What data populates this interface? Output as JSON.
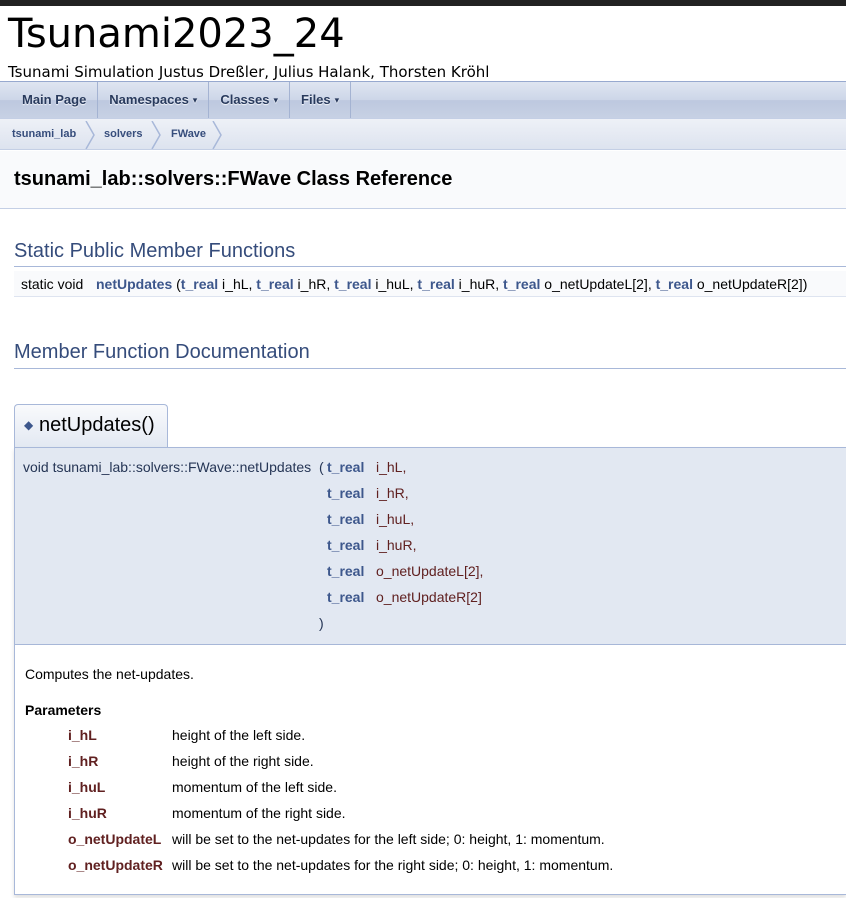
{
  "project": {
    "name": "Tsunami2023_24",
    "brief": "Tsunami Simulation Justus Dreßler, Julius Halank, Thorsten Kröhl"
  },
  "nav": {
    "items": [
      {
        "label": "Main Page",
        "caret": ""
      },
      {
        "label": "Namespaces",
        "caret": "▾"
      },
      {
        "label": "Classes",
        "caret": "▾"
      },
      {
        "label": "Files",
        "caret": "▾"
      }
    ]
  },
  "breadcrumb": [
    "tsunami_lab",
    "solvers",
    "FWave"
  ],
  "header": {
    "title": "tsunami_lab::solvers::FWave Class Reference"
  },
  "sections": {
    "static_public": "Static Public Member Functions",
    "member_doc": "Member Function Documentation"
  },
  "summary": {
    "return_type": "static void",
    "name": "netUpdates",
    "open": " (",
    "params": [
      {
        "type": "t_real",
        "name": " i_hL",
        "sep": ", "
      },
      {
        "type": "t_real",
        "name": " i_hR",
        "sep": ", "
      },
      {
        "type": "t_real",
        "name": " i_huL",
        "sep": ", "
      },
      {
        "type": "t_real",
        "name": " i_huR",
        "sep": ", "
      },
      {
        "type": "t_real",
        "name": " o_netUpdateL[2]",
        "sep": ", "
      },
      {
        "type": "t_real",
        "name": " o_netUpdateR[2]",
        "sep": ")"
      }
    ]
  },
  "member": {
    "tab_title": "netUpdates()",
    "diamond": "◆",
    "full_name": "void tsunami_lab::solvers::FWave::netUpdates",
    "open_paren": "(",
    "close_paren": ")",
    "params": [
      {
        "type": "t_real",
        "name": "i_hL,"
      },
      {
        "type": "t_real",
        "name": "i_hR,"
      },
      {
        "type": "t_real",
        "name": "i_huL,"
      },
      {
        "type": "t_real",
        "name": "i_huR,"
      },
      {
        "type": "t_real",
        "name": "o_netUpdateL[2],"
      },
      {
        "type": "t_real",
        "name": "o_netUpdateR[2]"
      }
    ],
    "brief": "Computes the net-updates.",
    "params_heading": "Parameters",
    "param_docs": [
      {
        "name": "i_hL",
        "desc": "height of the left side."
      },
      {
        "name": "i_hR",
        "desc": "height of the right side."
      },
      {
        "name": "i_huL",
        "desc": "momentum of the left side."
      },
      {
        "name": "i_huR",
        "desc": "momentum of the right side."
      },
      {
        "name": "o_netUpdateL",
        "desc": "will be set to the net-updates for the left side; 0: height, 1: momentum."
      },
      {
        "name": "o_netUpdateR",
        "desc": "will be set to the net-updates for the right side; 0: height, 1: momentum."
      }
    ]
  },
  "colors": {
    "link": "#3d578c",
    "param": "#602020",
    "heading": "#354c7b"
  }
}
